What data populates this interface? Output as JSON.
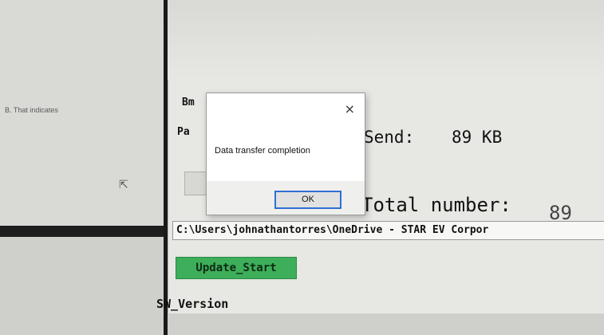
{
  "left_window": {
    "text_fragment": "B. That indicates"
  },
  "main": {
    "bm_label": "Bm",
    "pa_label": "Pa",
    "send_label": "Send:",
    "send_value": "89 KB",
    "total_label": "Total number:",
    "total_value": "89",
    "path_value": "C:\\Users\\johnathantorres\\OneDrive - STAR EV Corpor",
    "update_button_label": "Update_Start",
    "sw_version_label": "SW_Version"
  },
  "dialog": {
    "close_symbol": "×",
    "message": "Data transfer completion",
    "ok_label": "OK"
  },
  "colors": {
    "update_button": "#3dae5a",
    "ok_focus_border": "#2f6fd6"
  }
}
